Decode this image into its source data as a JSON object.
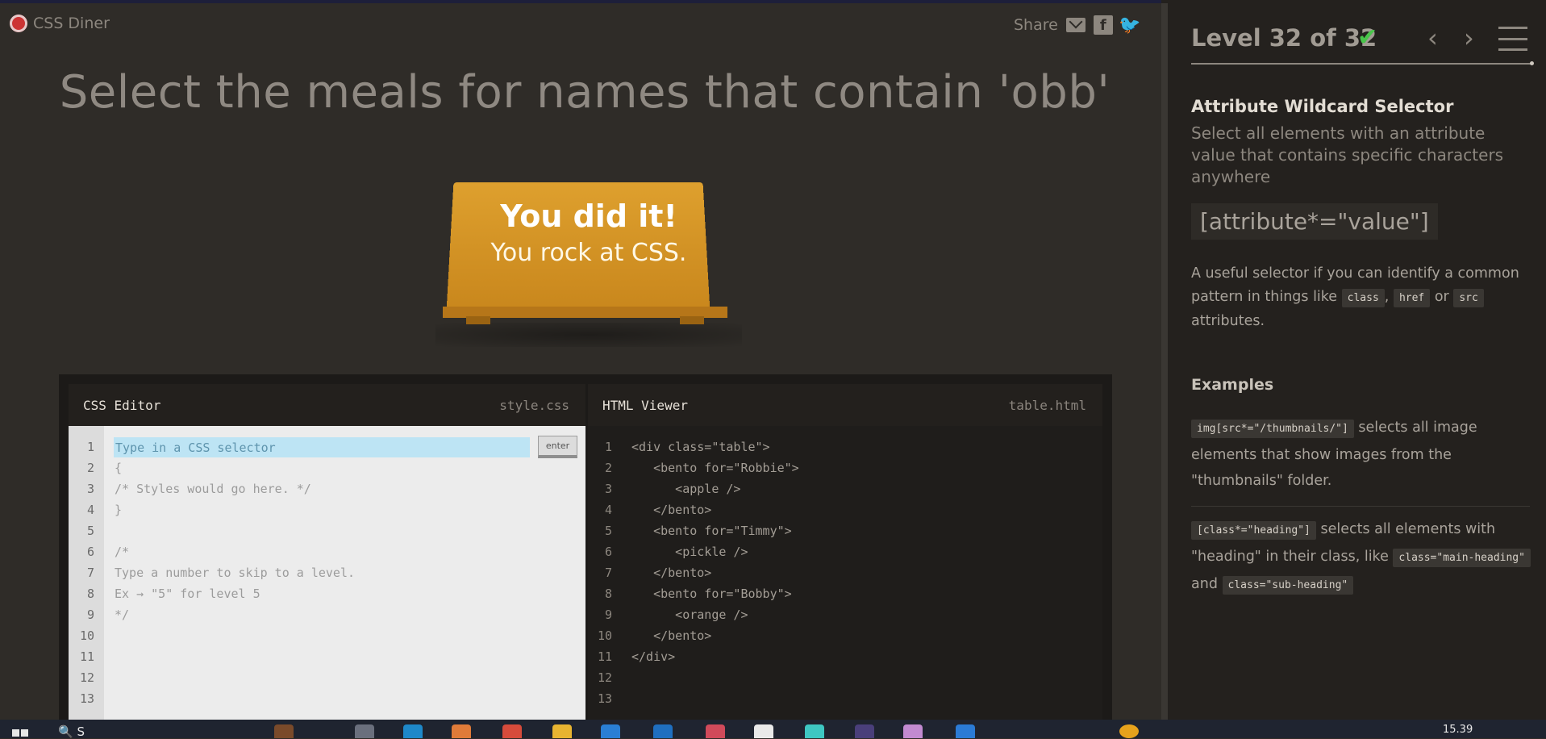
{
  "app": {
    "name": "CSS Diner"
  },
  "share": {
    "label": "Share"
  },
  "instruction": "Select the meals for names that contain 'obb'",
  "win_message": {
    "line1": "You did it!",
    "line2": "You rock at CSS."
  },
  "css_editor": {
    "title": "CSS Editor",
    "filename": "style.css",
    "placeholder": "Type in a CSS selector",
    "enter_label": "enter",
    "line_numbers": [
      "1",
      "2",
      "3",
      "4",
      "5",
      "6",
      "7",
      "8",
      "9",
      "10",
      "11",
      "12",
      "13"
    ],
    "lines": [
      "",
      "{",
      "/* Styles would go here. */",
      "}",
      "",
      "/*",
      "Type a number to skip to a level.",
      "Ex → \"5\" for level 5",
      "*/",
      "",
      "",
      "",
      ""
    ]
  },
  "html_viewer": {
    "title": "HTML Viewer",
    "filename": "table.html",
    "line_numbers": [
      "1",
      "2",
      "3",
      "4",
      "5",
      "6",
      "7",
      "8",
      "9",
      "10",
      "11",
      "12",
      "13"
    ],
    "lines": [
      "<div class=\"table\">",
      "   <bento for=\"Robbie\">",
      "      <apple />",
      "   </bento>",
      "   <bento for=\"Timmy\">",
      "      <pickle />",
      "   </bento>",
      "   <bento for=\"Bobby\">",
      "      <orange />",
      "   </bento>",
      "</div>",
      "",
      ""
    ]
  },
  "level": {
    "title": "Level 32 of 32",
    "current": 32,
    "total": 32,
    "completed": true,
    "progress_fraction": 1.0
  },
  "selector": {
    "name": "Attribute Wildcard Selector",
    "description": "Select all elements with an attribute value that contains specific characters anywhere",
    "syntax": "[attribute*=\"value\"]",
    "hint_pre": "A useful selector if you can identify a common pattern in things like",
    "hint_codes": [
      "class",
      "href",
      "src"
    ],
    "hint_sep1": ",",
    "hint_sep2": "or",
    "hint_post": "attributes."
  },
  "examples": {
    "heading": "Examples",
    "e1_code": "img[src*=\"/thumbnails/\"]",
    "e1_text": "selects all image elements that show images from the \"thumbnails\" folder.",
    "e2_code": "[class*=\"heading\"]",
    "e2_text": "selects all elements with \"heading\" in their class, like",
    "e2_code2": "class=\"main-heading\"",
    "e2_and": "and",
    "e2_code3": "class=\"sub-heading\""
  },
  "taskbar": {
    "search_text": "S",
    "time": "15.39"
  },
  "colors": {
    "accent_check": "#49c54a",
    "table_orange": "#dea02e",
    "input_highlight": "#bde4f4"
  }
}
